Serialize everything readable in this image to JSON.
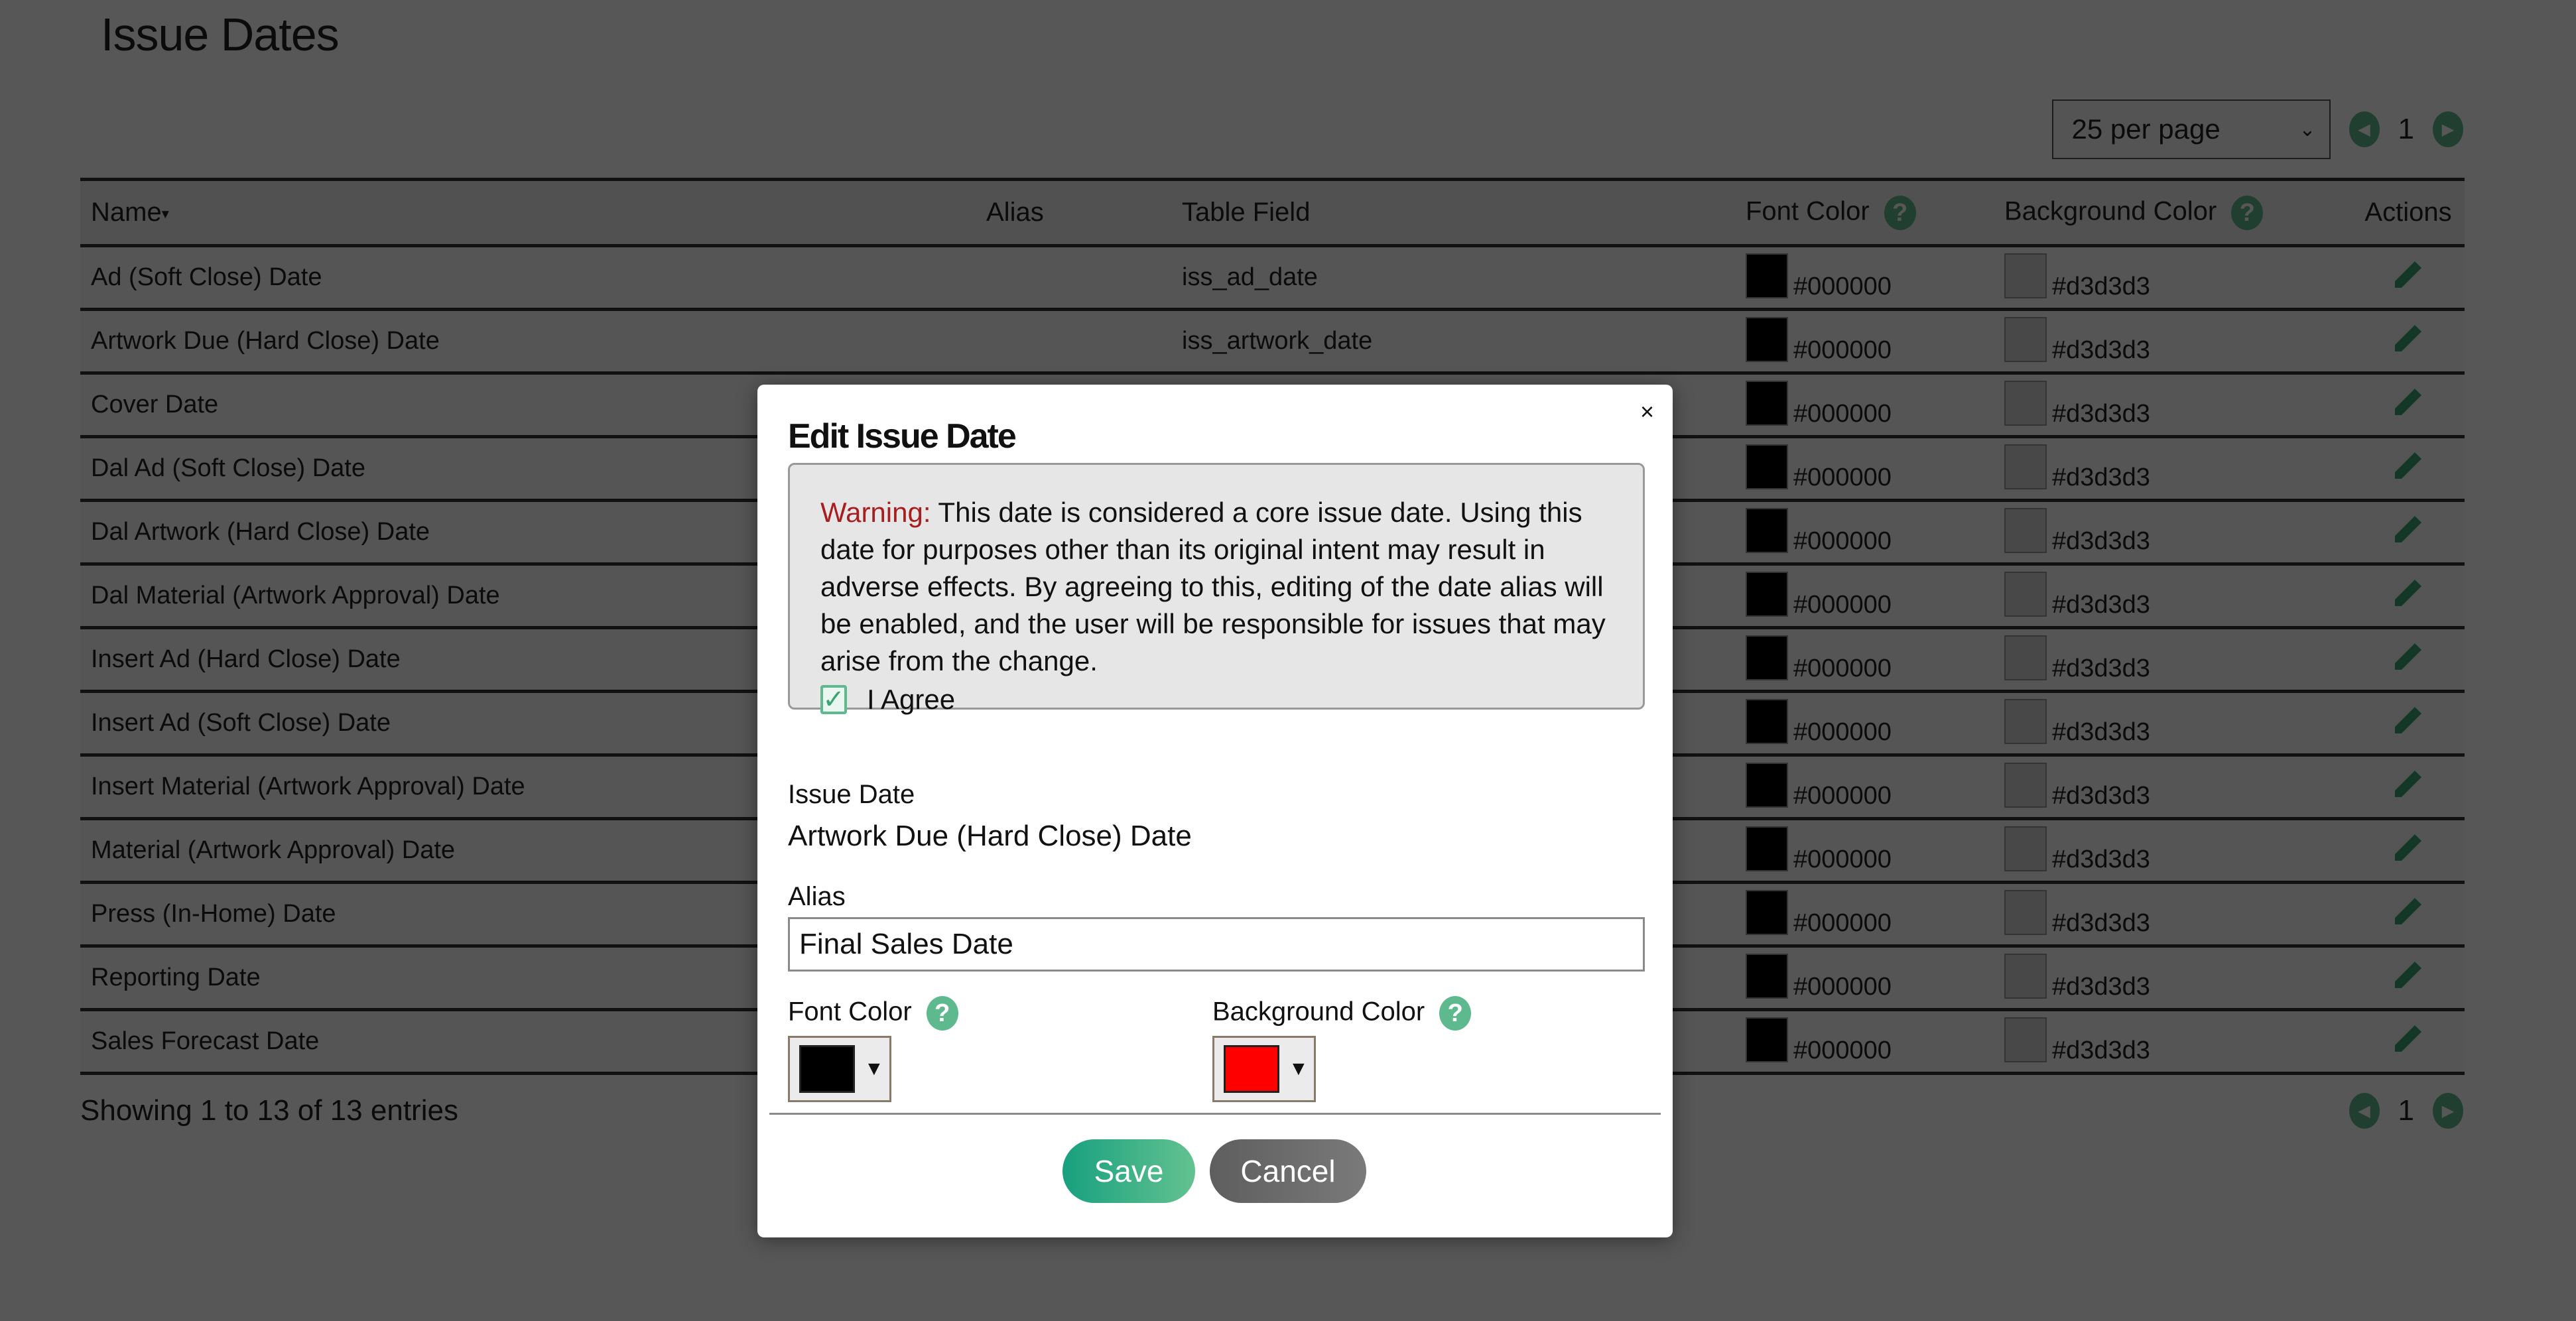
{
  "page": {
    "title": "Issue Dates"
  },
  "pagination": {
    "per_page": "25 per page",
    "current_page": "1",
    "prev_icon": "chevron-left-icon",
    "next_icon": "chevron-right-icon",
    "summary": "Showing 1 to 13 of 13 entries"
  },
  "table": {
    "columns": {
      "name": "Name",
      "alias": "Alias",
      "table_field": "Table Field",
      "font_color": "Font Color",
      "background_color": "Background Color",
      "actions": "Actions"
    },
    "help_glyph": "?",
    "sort_glyph": "▾",
    "rows": [
      {
        "name": "Ad (Soft Close) Date",
        "alias": "",
        "table_field": "iss_ad_date",
        "font_color": "#000000",
        "background_color": "#d3d3d3"
      },
      {
        "name": "Artwork Due (Hard Close) Date",
        "alias": "",
        "table_field": "iss_artwork_date",
        "font_color": "#000000",
        "background_color": "#d3d3d3"
      },
      {
        "name": "Cover Date",
        "alias": "",
        "table_field": "",
        "font_color": "#000000",
        "background_color": "#d3d3d3"
      },
      {
        "name": "Dal Ad (Soft Close) Date",
        "alias": "",
        "table_field": "",
        "font_color": "#000000",
        "background_color": "#d3d3d3"
      },
      {
        "name": "Dal Artwork (Hard Close) Date",
        "alias": "",
        "table_field": "",
        "font_color": "#000000",
        "background_color": "#d3d3d3"
      },
      {
        "name": "Dal Material (Artwork Approval) Date",
        "alias": "",
        "table_field": "",
        "font_color": "#000000",
        "background_color": "#d3d3d3"
      },
      {
        "name": "Insert Ad (Hard Close) Date",
        "alias": "",
        "table_field": "",
        "font_color": "#000000",
        "background_color": "#d3d3d3"
      },
      {
        "name": "Insert Ad (Soft Close) Date",
        "alias": "",
        "table_field": "",
        "font_color": "#000000",
        "background_color": "#d3d3d3"
      },
      {
        "name": "Insert Material (Artwork Approval) Date",
        "alias": "",
        "table_field": "",
        "font_color": "#000000",
        "background_color": "#d3d3d3"
      },
      {
        "name": "Material (Artwork Approval) Date",
        "alias": "",
        "table_field": "",
        "font_color": "#000000",
        "background_color": "#d3d3d3"
      },
      {
        "name": "Press (In-Home) Date",
        "alias": "",
        "table_field": "",
        "font_color": "#000000",
        "background_color": "#d3d3d3"
      },
      {
        "name": "Reporting Date",
        "alias": "",
        "table_field": "",
        "font_color": "#000000",
        "background_color": "#d3d3d3"
      },
      {
        "name": "Sales Forecast Date",
        "alias": "",
        "table_field": "",
        "font_color": "#000000",
        "background_color": "#d3d3d3"
      }
    ]
  },
  "modal": {
    "title": "Edit Issue Date",
    "close_label": "×",
    "warning_label": "Warning:",
    "warning_text": " This date is considered a core issue date. Using this date for purposes other than its original intent may result in adverse effects. By agreeing to this, editing of the date alias will be enabled, and the user will be responsible for issues that may arise from the change.",
    "agree_label": "I Agree",
    "agree_checked": true,
    "check_glyph": "✓",
    "issue_date_label": "Issue Date",
    "issue_date_value": "Artwork Due (Hard Close) Date",
    "alias_label": "Alias",
    "alias_value": "Final Sales Date",
    "font_color_label": "Font Color",
    "font_color_value": "#000000",
    "background_color_label": "Background Color",
    "background_color_value": "#ff0000",
    "dropdown_glyph": "▼",
    "save_label": "Save",
    "cancel_label": "Cancel"
  },
  "colors": {
    "accent": "#5fb98f",
    "warning": "#a81d1d",
    "save_gradient_start": "#18a07f",
    "save_gradient_end": "#63c290"
  }
}
